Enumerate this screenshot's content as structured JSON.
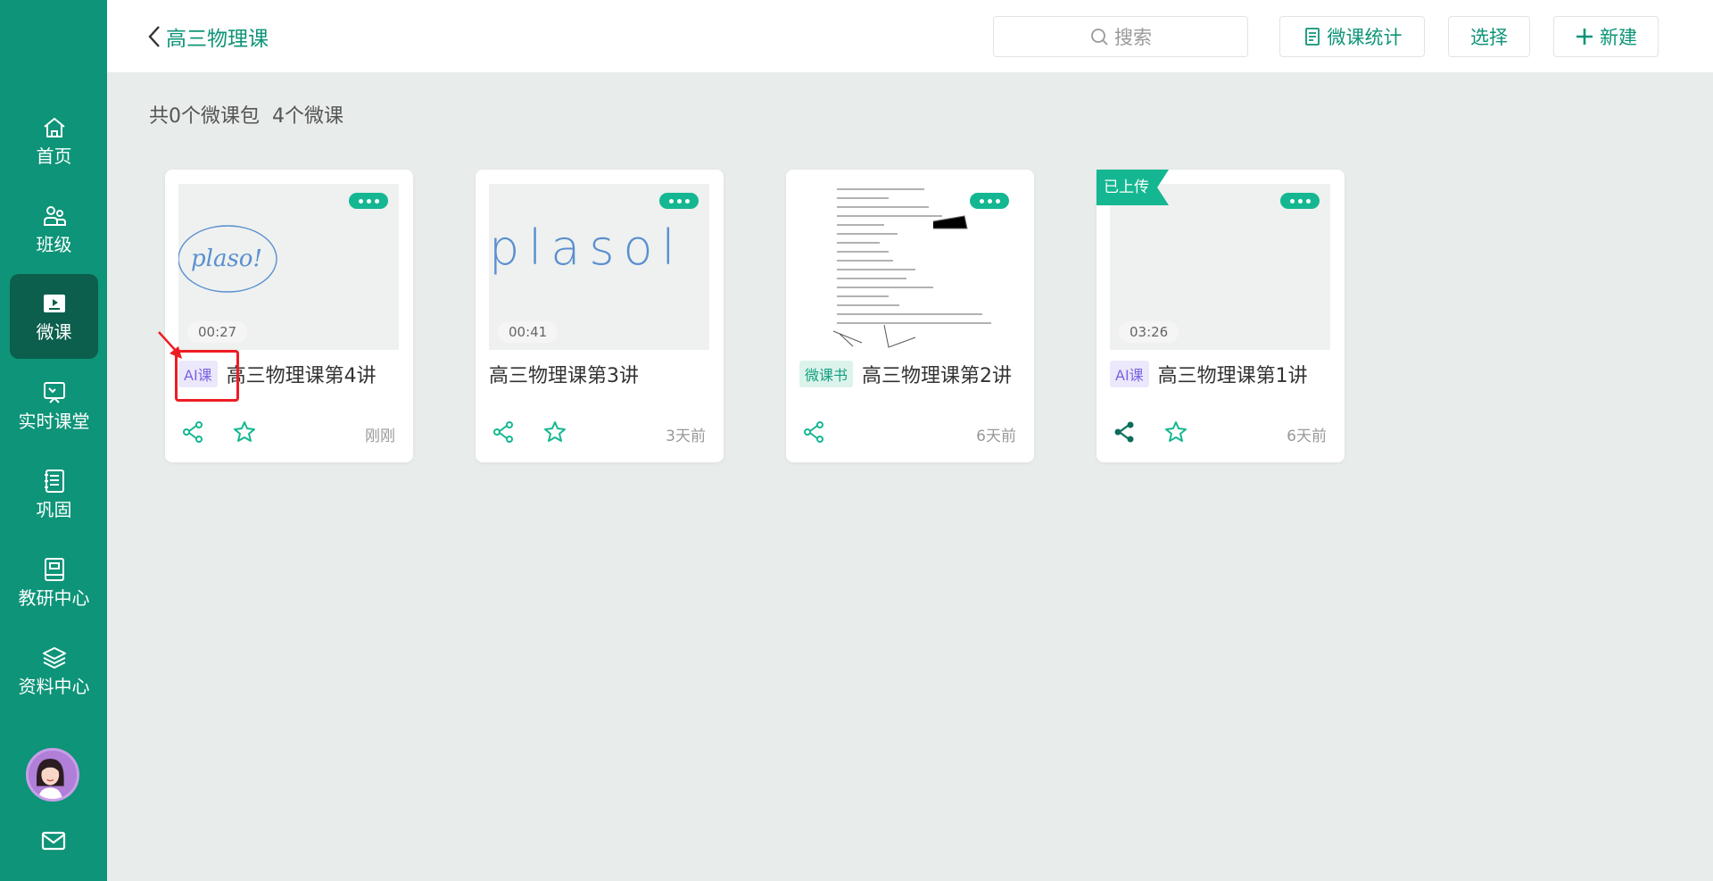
{
  "sidebar": {
    "items": [
      {
        "label": "首页",
        "icon": "home-icon"
      },
      {
        "label": "班级",
        "icon": "class-icon"
      },
      {
        "label": "微课",
        "icon": "video-icon"
      },
      {
        "label": "实时课堂",
        "icon": "board-icon"
      },
      {
        "label": "巩固",
        "icon": "notebook-icon"
      },
      {
        "label": "教研中心",
        "icon": "book-icon"
      },
      {
        "label": "资料中心",
        "icon": "layers-icon"
      }
    ],
    "active_index": 2
  },
  "header": {
    "back_title": "高三物理课",
    "search_placeholder": "搜索",
    "stats_label": "微课统计",
    "select_label": "选择",
    "new_label": "新建"
  },
  "summary": {
    "packages": "共0个微课包",
    "lessons": "4个微课"
  },
  "cards": [
    {
      "title": "高三物理课第4讲",
      "tag": "AI课",
      "duration": "00:27",
      "time": "刚刚",
      "ribbon": ""
    },
    {
      "title": "高三物理课第3讲",
      "tag": "",
      "duration": "00:41",
      "time": "3天前",
      "ribbon": ""
    },
    {
      "title": "高三物理课第2讲",
      "tag": "微课书",
      "duration": "",
      "time": "6天前",
      "ribbon": ""
    },
    {
      "title": "高三物理课第1讲",
      "tag": "AI课",
      "duration": "03:26",
      "time": "6天前",
      "ribbon": "已上传"
    }
  ],
  "thumb_text": {
    "card1": "plaso!",
    "card2": "plasol"
  },
  "colors": {
    "brand": "#0e9478",
    "sidebar_active": "#0b5f4c",
    "accent": "#14b791",
    "highlight": "#ee1c24"
  }
}
